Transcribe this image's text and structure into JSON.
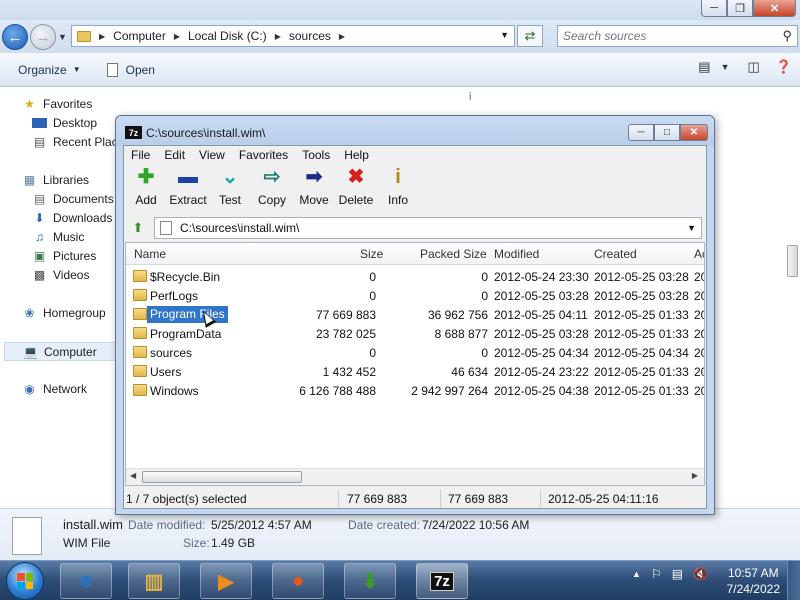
{
  "explorer": {
    "window_controls": [
      "─",
      "❐",
      "✕"
    ],
    "address": {
      "breadcrumbs": [
        "Computer",
        "Local Disk (C:)",
        "sources"
      ]
    },
    "search": {
      "placeholder": "Search sources"
    },
    "commands": {
      "organize": "Organize",
      "open": "Open"
    },
    "nav": {
      "favorites": "Favorites",
      "desktop": "Desktop",
      "recent_places": "Recent Plac",
      "libraries": "Libraries",
      "documents": "Documents",
      "downloads": "Downloads",
      "music": "Music",
      "pictures": "Pictures",
      "videos": "Videos",
      "homegroup": "Homegroup",
      "computer": "Computer",
      "network": "Network"
    },
    "content_marker": "i",
    "details": {
      "filename": "install.wim",
      "filetype": "WIM File",
      "date_modified_label": "Date modified:",
      "date_modified": "5/25/2012 4:57 AM",
      "date_created_label": "Date created:",
      "date_created": "7/24/2022 10:56 AM",
      "size_label": "Size:",
      "size": "1.49 GB"
    }
  },
  "sevenzip": {
    "logo": "7z",
    "title": "C:\\sources\\install.wim\\",
    "menu": [
      "File",
      "Edit",
      "View",
      "Favorites",
      "Tools",
      "Help"
    ],
    "toolbar": [
      {
        "label": "Add",
        "icon": "plus-icon",
        "glyph": "✚",
        "color": "#2fa82a"
      },
      {
        "label": "Extract",
        "icon": "minus-icon",
        "glyph": "▬",
        "color": "#1f3fae"
      },
      {
        "label": "Test",
        "icon": "check-icon",
        "glyph": "⌄",
        "color": "#21a6a6"
      },
      {
        "label": "Copy",
        "icon": "copy-arrow-icon",
        "glyph": "⇨",
        "color": "#237c72"
      },
      {
        "label": "Move",
        "icon": "move-arrow-icon",
        "glyph": "➡",
        "color": "#1d2a8a"
      },
      {
        "label": "Delete",
        "icon": "delete-x-icon",
        "glyph": "✖",
        "color": "#d3201b"
      },
      {
        "label": "Info",
        "icon": "info-icon",
        "glyph": "i",
        "color": "#b58a00"
      }
    ],
    "path": "C:\\sources\\install.wim\\",
    "columns": {
      "name": "Name",
      "size": "Size",
      "packed": "Packed Size",
      "modified": "Modified",
      "created": "Created",
      "accessed": "Ac"
    },
    "rows": [
      {
        "name": "$Recycle.Bin",
        "size": "0",
        "packed": "0",
        "modified": "2012-05-24 23:30",
        "created": "2012-05-25 03:28",
        "accessed": "20"
      },
      {
        "name": "PerfLogs",
        "size": "0",
        "packed": "0",
        "modified": "2012-05-25 03:28",
        "created": "2012-05-25 03:28",
        "accessed": "20"
      },
      {
        "name": "Program Files",
        "size": "77 669 883",
        "packed": "36 962 756",
        "modified": "2012-05-25 04:11",
        "created": "2012-05-25 01:33",
        "accessed": "20",
        "selected": true
      },
      {
        "name": "ProgramData",
        "size": "23 782 025",
        "packed": "8 688 877",
        "modified": "2012-05-25 03:28",
        "created": "2012-05-25 01:33",
        "accessed": "20"
      },
      {
        "name": "sources",
        "size": "0",
        "packed": "0",
        "modified": "2012-05-25 04:34",
        "created": "2012-05-25 04:34",
        "accessed": "20"
      },
      {
        "name": "Users",
        "size": "1 432 452",
        "packed": "46 634",
        "modified": "2012-05-24 23:22",
        "created": "2012-05-25 01:33",
        "accessed": "20"
      },
      {
        "name": "Windows",
        "size": "6 126 788 488",
        "packed": "2 942 997 264",
        "modified": "2012-05-25 04:38",
        "created": "2012-05-25 01:33",
        "accessed": "20"
      }
    ],
    "status": {
      "selection": "1 / 7 object(s) selected",
      "size": "77 669 883",
      "packed": "77 669 883",
      "modified": "2012-05-25 04:11:16"
    }
  },
  "taskbar": {
    "buttons": [
      {
        "name": "internet-explorer-taskbar-button",
        "glyph": "e",
        "color": "#1f77d4"
      },
      {
        "name": "file-explorer-taskbar-button",
        "glyph": "▥",
        "color": "#e2b24a"
      },
      {
        "name": "media-player-taskbar-button",
        "glyph": "▶",
        "color": "#f08a1c"
      },
      {
        "name": "firefox-taskbar-button",
        "glyph": "●",
        "color": "#e8591f"
      },
      {
        "name": "download-manager-taskbar-button",
        "glyph": "⬇",
        "color": "#3c9a2c"
      },
      {
        "name": "sevenzip-taskbar-button",
        "glyph": "7z",
        "color": "#ffffff"
      }
    ],
    "time": "10:57 AM",
    "date": "7/24/2022"
  }
}
